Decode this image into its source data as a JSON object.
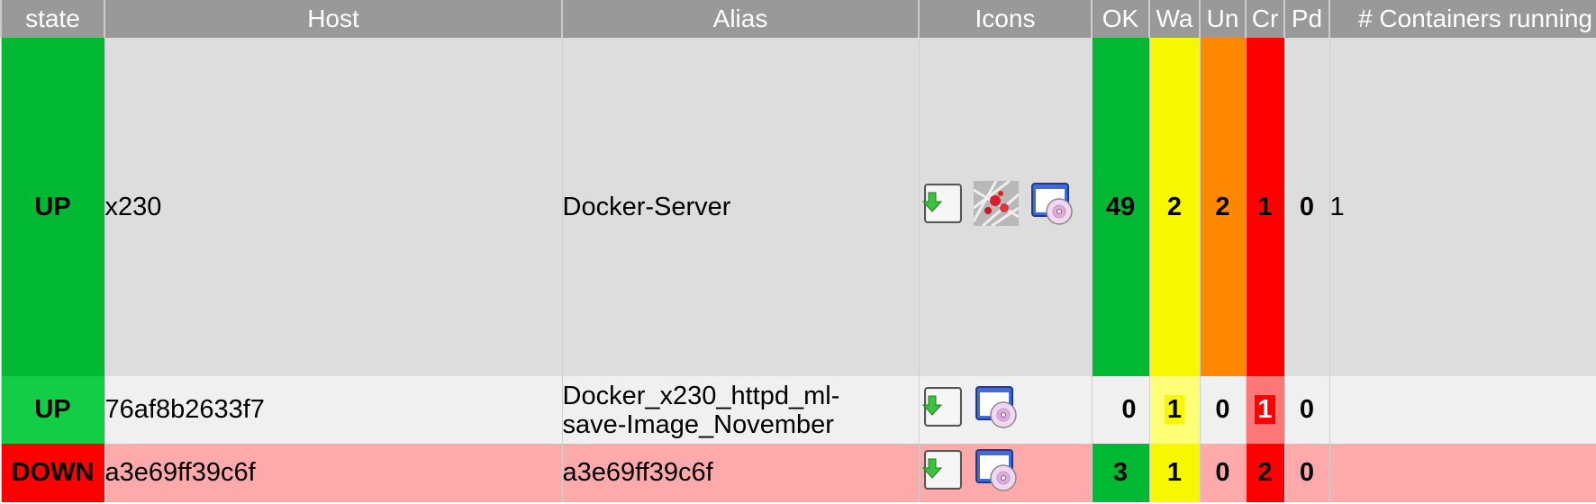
{
  "columns": {
    "state": "state",
    "host": "Host",
    "alias": "Alias",
    "icons": "Icons",
    "ok": "OK",
    "wa": "Wa",
    "un": "Un",
    "cr": "Cr",
    "pd": "Pd",
    "containers": "# Containers running"
  },
  "rows": [
    {
      "state": "UP",
      "host": "x230",
      "alias": "Docker-Server",
      "icons": [
        "download-icon",
        "photo-thumbnail-icon",
        "disc-window-icon"
      ],
      "ok": "49",
      "wa": "2",
      "un": "2",
      "cr": "1",
      "pd": "0",
      "containers": "1"
    },
    {
      "state": "UP",
      "host": "76af8b2633f7",
      "alias_line1": "Docker_x230_httpd_ml-",
      "alias_line2": "save-Image_November",
      "icons": [
        "download-icon",
        "disc-window-icon"
      ],
      "ok": "0",
      "wa": "1",
      "un": "0",
      "cr": "1",
      "pd": "0",
      "containers": ""
    },
    {
      "state": "DOWN",
      "host": "a3e69ff39c6f",
      "alias": "a3e69ff39c6f",
      "icons": [
        "download-icon",
        "disc-window-icon"
      ],
      "ok": "3",
      "wa": "1",
      "un": "0",
      "cr": "2",
      "pd": "0",
      "containers": ""
    }
  ],
  "colors": {
    "up": "#00b832",
    "down": "#ff0000",
    "warning": "#f7f700",
    "unknown": "#ff8800",
    "critical": "#ff0000",
    "header": "#999999"
  }
}
